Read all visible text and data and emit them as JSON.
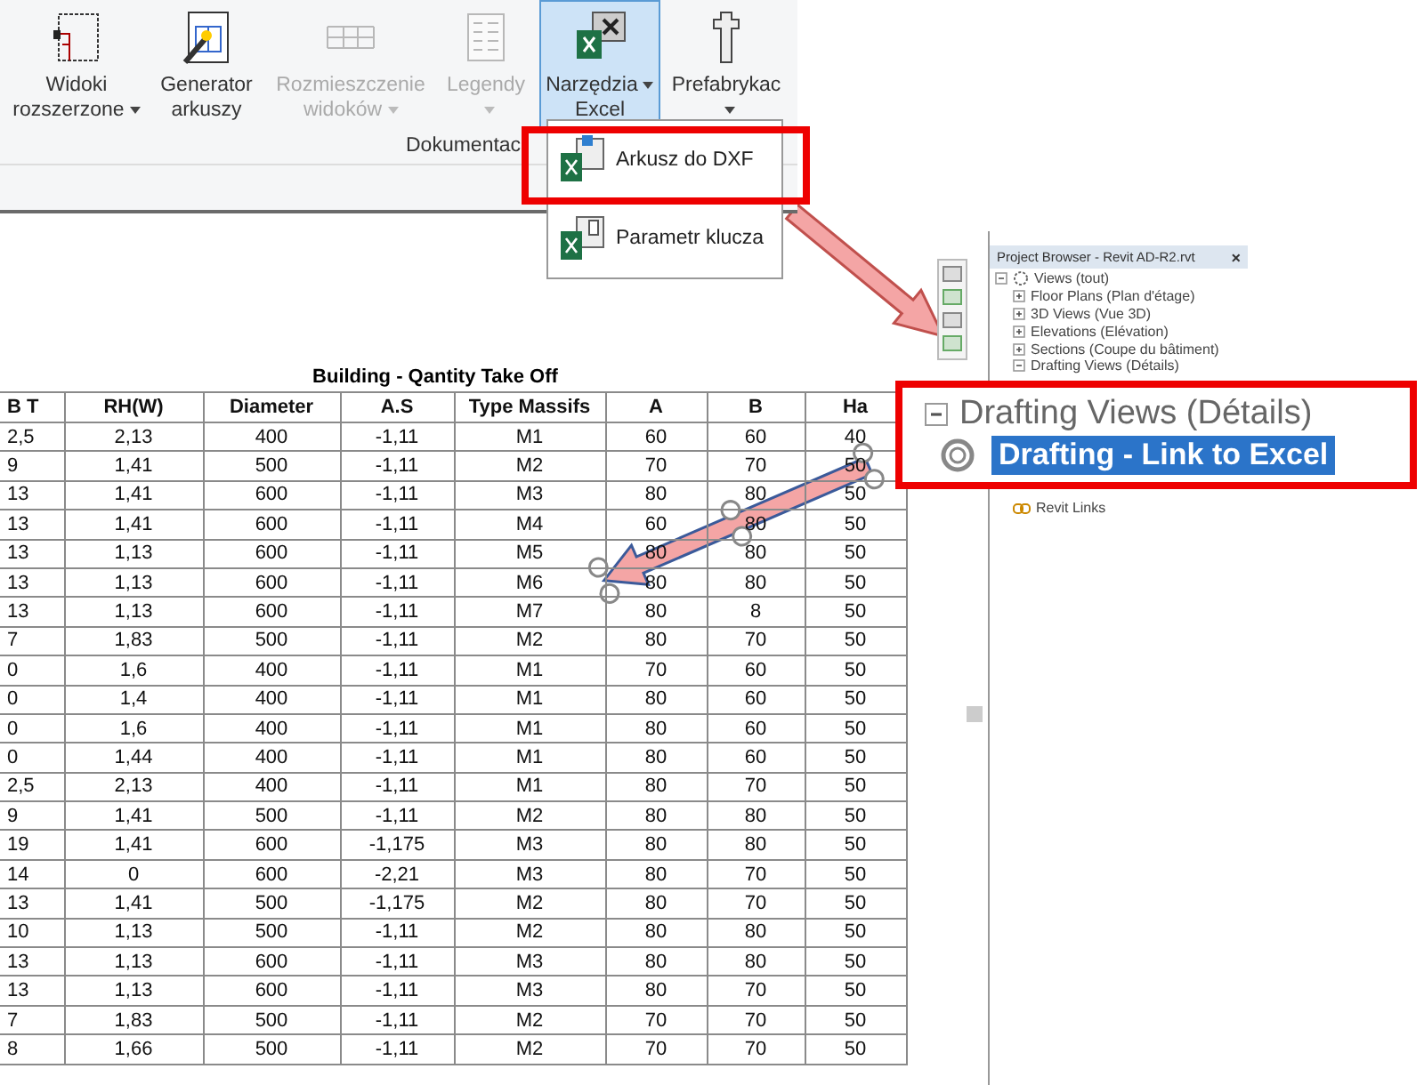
{
  "ribbon": {
    "buttons": [
      {
        "lines": [
          "Widoki",
          "rozszerzone"
        ],
        "dropdown": true,
        "disabled": false,
        "selected": false
      },
      {
        "lines": [
          "Generator",
          "arkuszy"
        ],
        "dropdown": false,
        "disabled": false,
        "selected": false
      },
      {
        "lines": [
          "Rozmieszczenie",
          "widoków"
        ],
        "dropdown": true,
        "disabled": true,
        "selected": false
      },
      {
        "lines": [
          "Legendy"
        ],
        "dropdown": true,
        "disabled": true,
        "selected": false
      },
      {
        "lines": [
          "Narzędzia",
          "Excel"
        ],
        "dropdown": true,
        "disabled": false,
        "selected": true
      },
      {
        "lines": [
          "Prefabrykac"
        ],
        "dropdown": true,
        "disabled": false,
        "selected": false
      }
    ],
    "panel_label": "Dokumentac"
  },
  "dropdown_menu": {
    "items": [
      {
        "label": "Arkusz do DXF",
        "highlighted": true
      },
      {
        "label": "Parametr klucza",
        "highlighted": false
      }
    ]
  },
  "table": {
    "title": "Building - Qantity Take Off",
    "columns": [
      "B T",
      "RH(W)",
      "Diameter",
      "A.S",
      "Type Massifs",
      "A",
      "B",
      "Ha"
    ],
    "rows": [
      [
        "2,5",
        "2,13",
        "400",
        "-1,11",
        "M1",
        "60",
        "60",
        "40"
      ],
      [
        "9",
        "1,41",
        "500",
        "-1,11",
        "M2",
        "70",
        "70",
        "50"
      ],
      [
        "13",
        "1,41",
        "600",
        "-1,11",
        "M3",
        "80",
        "80",
        "50"
      ],
      [
        "13",
        "1,41",
        "600",
        "-1,11",
        "M4",
        "60",
        "80",
        "50"
      ],
      [
        "13",
        "1,13",
        "600",
        "-1,11",
        "M5",
        "80",
        "80",
        "50"
      ],
      [
        "13",
        "1,13",
        "600",
        "-1,11",
        "M6",
        "80",
        "80",
        "50"
      ],
      [
        "13",
        "1,13",
        "600",
        "-1,11",
        "M7",
        "80",
        "8",
        "50"
      ],
      [
        "7",
        "1,83",
        "500",
        "-1,11",
        "M2",
        "80",
        "70",
        "50"
      ],
      [
        "0",
        "1,6",
        "400",
        "-1,11",
        "M1",
        "70",
        "60",
        "50"
      ],
      [
        "0",
        "1,4",
        "400",
        "-1,11",
        "M1",
        "80",
        "60",
        "50"
      ],
      [
        "0",
        "1,6",
        "400",
        "-1,11",
        "M1",
        "80",
        "60",
        "50"
      ],
      [
        "0",
        "1,44",
        "400",
        "-1,11",
        "M1",
        "80",
        "60",
        "50"
      ],
      [
        "2,5",
        "2,13",
        "400",
        "-1,11",
        "M1",
        "80",
        "70",
        "50"
      ],
      [
        "9",
        "1,41",
        "500",
        "-1,11",
        "M2",
        "80",
        "80",
        "50"
      ],
      [
        "19",
        "1,41",
        "600",
        "-1,175",
        "M3",
        "80",
        "80",
        "50"
      ],
      [
        "14",
        "0",
        "600",
        "-2,21",
        "M3",
        "80",
        "70",
        "50"
      ],
      [
        "13",
        "1,41",
        "500",
        "-1,175",
        "M2",
        "80",
        "70",
        "50"
      ],
      [
        "10",
        "1,13",
        "500",
        "-1,11",
        "M2",
        "80",
        "80",
        "50"
      ],
      [
        "13",
        "1,13",
        "600",
        "-1,11",
        "M3",
        "80",
        "80",
        "50"
      ],
      [
        "13",
        "1,13",
        "600",
        "-1,11",
        "M3",
        "80",
        "70",
        "50"
      ],
      [
        "7",
        "1,83",
        "500",
        "-1,11",
        "M2",
        "70",
        "70",
        "50"
      ],
      [
        "8",
        "1,66",
        "500",
        "-1,11",
        "M2",
        "70",
        "70",
        "50"
      ]
    ]
  },
  "project_browser": {
    "title": "Project Browser - Revit  AD-R2.rvt",
    "close": "×",
    "tree": [
      {
        "label": "Views (tout)",
        "kind": "views",
        "expanded": true,
        "children": [
          {
            "label": "Floor Plans (Plan d'étage)",
            "expanded": false
          },
          {
            "label": "3D Views (Vue 3D)",
            "expanded": false
          },
          {
            "label": "Elevations (Elévation)",
            "expanded": false
          },
          {
            "label": "Sections (Coupe du bâtiment)",
            "expanded": false
          },
          {
            "label": "Drafting Views (Détails)",
            "expanded": true
          }
        ]
      },
      {
        "label": "Revit Links",
        "kind": "links"
      }
    ]
  },
  "zoom_callout": {
    "heading": "Drafting Views (Détails)",
    "heading_expanded": true,
    "item": {
      "label": "Drafting - Link to Excel",
      "selected": true
    }
  }
}
